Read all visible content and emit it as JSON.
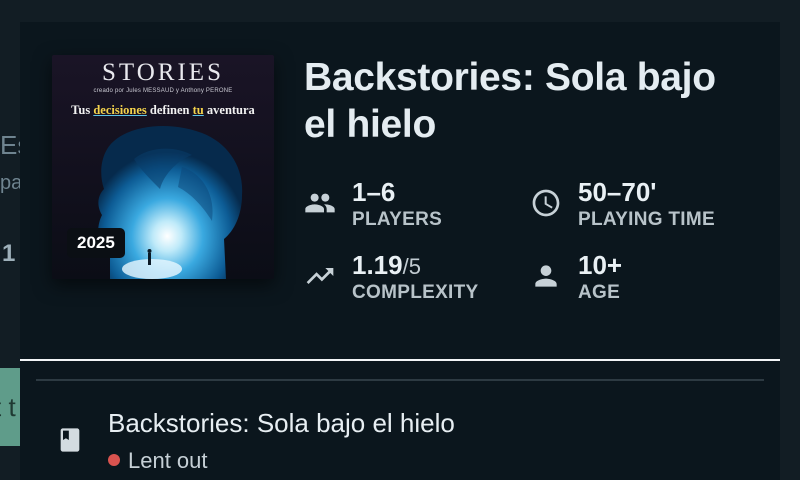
{
  "background": {
    "partial_texts": [
      "Es",
      "pa",
      "1",
      "t t"
    ]
  },
  "game": {
    "title": "Backstories: Sola bajo el hielo",
    "year": "2025",
    "cover": {
      "brand": "STORIES",
      "credits": "creado por Jules MESSAUD y Anthony PERONE",
      "tagline_parts": [
        "Tus ",
        "decisiones",
        " definen ",
        "tu",
        " aventura"
      ]
    },
    "stats": {
      "players": {
        "value": "1–6",
        "label": "PLAYERS",
        "icon": "group-icon"
      },
      "playing_time": {
        "value": "50–70'",
        "label": "PLAYING TIME",
        "icon": "clock-icon"
      },
      "complexity": {
        "value": "1.19",
        "max": "/5",
        "label": "COMPLEXITY",
        "icon": "trending-up-icon"
      },
      "age": {
        "value": "10+",
        "label": "AGE",
        "icon": "person-icon"
      }
    }
  },
  "collection_item": {
    "title": "Backstories: Sola bajo el hielo",
    "status": "Lent out",
    "status_color": "#d9534f",
    "icon": "book-icon"
  }
}
